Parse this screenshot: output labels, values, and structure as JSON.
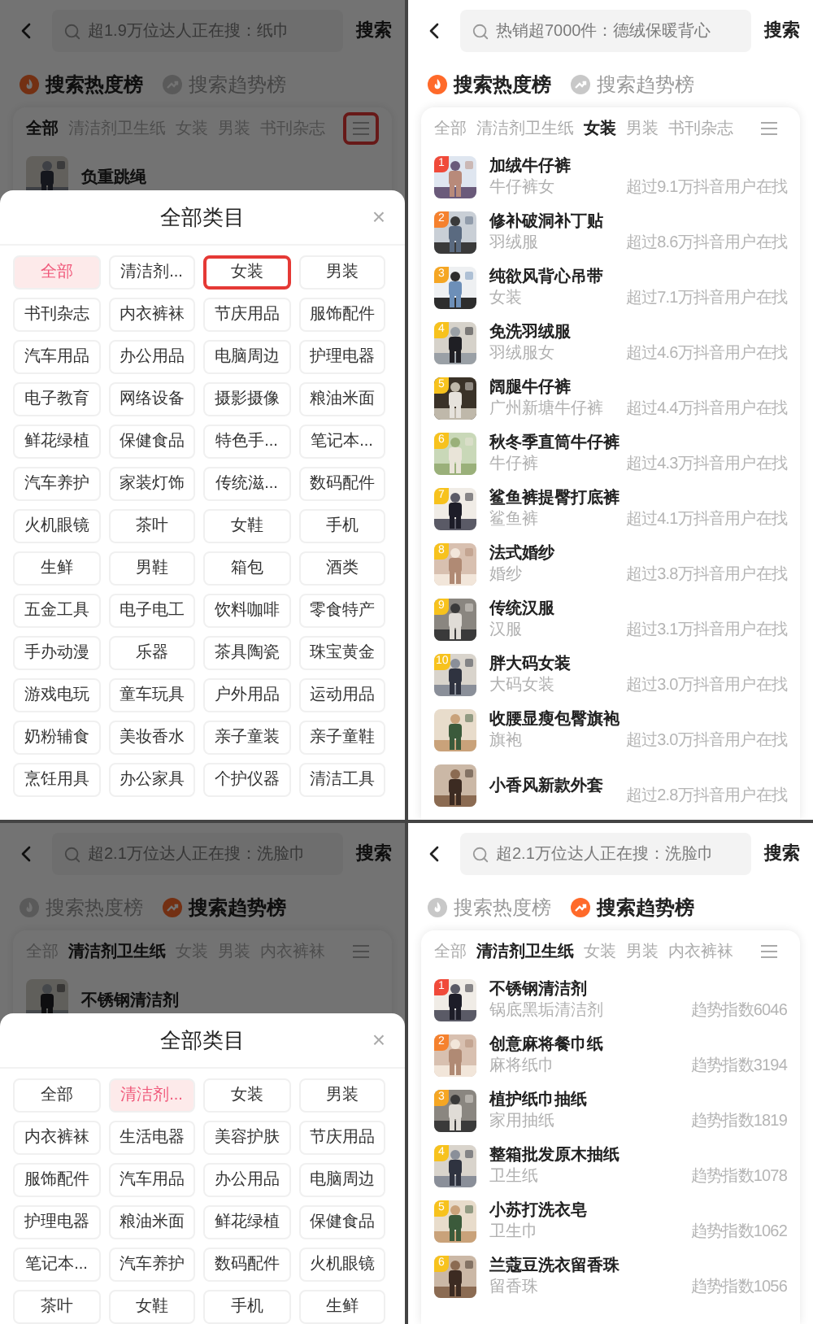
{
  "panels": [
    {
      "search": {
        "placeholder": "超1.9万位达人正在搜：纸巾",
        "button": "搜索"
      },
      "rank_tabs": [
        {
          "kind": "hot",
          "label": "搜索热度榜",
          "selected": true
        },
        {
          "kind": "trend",
          "label": "搜索趋势榜",
          "selected": false
        }
      ],
      "category_tabs": {
        "items": [
          {
            "label": "全部",
            "selected": true
          },
          {
            "label": "清洁剂卫生纸",
            "selected": false
          },
          {
            "label": "女装",
            "selected": false
          },
          {
            "label": "男装",
            "selected": false
          },
          {
            "label": "书刊杂志",
            "selected": false
          }
        ],
        "menu_annotated": true
      },
      "list": [
        {
          "title": "负重跳绳"
        }
      ],
      "sheet": {
        "title": "全部类目",
        "close": "×",
        "categories": [
          {
            "label": "全部",
            "selected": true,
            "annotated": false
          },
          {
            "label": "清洁剂...",
            "selected": false,
            "annotated": false
          },
          {
            "label": "女装",
            "selected": false,
            "annotated": true
          },
          {
            "label": "男装",
            "selected": false,
            "annotated": false
          },
          {
            "label": "书刊杂志",
            "selected": false,
            "annotated": false
          },
          {
            "label": "内衣裤袜",
            "selected": false,
            "annotated": false
          },
          {
            "label": "节庆用品",
            "selected": false,
            "annotated": false
          },
          {
            "label": "服饰配件",
            "selected": false,
            "annotated": false
          },
          {
            "label": "汽车用品",
            "selected": false,
            "annotated": false
          },
          {
            "label": "办公用品",
            "selected": false,
            "annotated": false
          },
          {
            "label": "电脑周边",
            "selected": false,
            "annotated": false
          },
          {
            "label": "护理电器",
            "selected": false,
            "annotated": false
          },
          {
            "label": "电子教育",
            "selected": false,
            "annotated": false
          },
          {
            "label": "网络设备",
            "selected": false,
            "annotated": false
          },
          {
            "label": "摄影摄像",
            "selected": false,
            "annotated": false
          },
          {
            "label": "粮油米面",
            "selected": false,
            "annotated": false
          },
          {
            "label": "鲜花绿植",
            "selected": false,
            "annotated": false
          },
          {
            "label": "保健食品",
            "selected": false,
            "annotated": false
          },
          {
            "label": "特色手...",
            "selected": false,
            "annotated": false
          },
          {
            "label": "笔记本...",
            "selected": false,
            "annotated": false
          },
          {
            "label": "汽车养护",
            "selected": false,
            "annotated": false
          },
          {
            "label": "家装灯饰",
            "selected": false,
            "annotated": false
          },
          {
            "label": "传统滋...",
            "selected": false,
            "annotated": false
          },
          {
            "label": "数码配件",
            "selected": false,
            "annotated": false
          },
          {
            "label": "火机眼镜",
            "selected": false,
            "annotated": false
          },
          {
            "label": "茶叶",
            "selected": false,
            "annotated": false
          },
          {
            "label": "女鞋",
            "selected": false,
            "annotated": false
          },
          {
            "label": "手机",
            "selected": false,
            "annotated": false
          },
          {
            "label": "生鲜",
            "selected": false,
            "annotated": false
          },
          {
            "label": "男鞋",
            "selected": false,
            "annotated": false
          },
          {
            "label": "箱包",
            "selected": false,
            "annotated": false
          },
          {
            "label": "酒类",
            "selected": false,
            "annotated": false
          },
          {
            "label": "五金工具",
            "selected": false,
            "annotated": false
          },
          {
            "label": "电子电工",
            "selected": false,
            "annotated": false
          },
          {
            "label": "饮料咖啡",
            "selected": false,
            "annotated": false
          },
          {
            "label": "零食特产",
            "selected": false,
            "annotated": false
          },
          {
            "label": "手办动漫",
            "selected": false,
            "annotated": false
          },
          {
            "label": "乐器",
            "selected": false,
            "annotated": false
          },
          {
            "label": "茶具陶瓷",
            "selected": false,
            "annotated": false
          },
          {
            "label": "珠宝黄金",
            "selected": false,
            "annotated": false
          },
          {
            "label": "游戏电玩",
            "selected": false,
            "annotated": false
          },
          {
            "label": "童车玩具",
            "selected": false,
            "annotated": false
          },
          {
            "label": "户外用品",
            "selected": false,
            "annotated": false
          },
          {
            "label": "运动用品",
            "selected": false,
            "annotated": false
          },
          {
            "label": "奶粉辅食",
            "selected": false,
            "annotated": false
          },
          {
            "label": "美妆香水",
            "selected": false,
            "annotated": false
          },
          {
            "label": "亲子童装",
            "selected": false,
            "annotated": false
          },
          {
            "label": "亲子童鞋",
            "selected": false,
            "annotated": false
          },
          {
            "label": "烹饪用具",
            "selected": false,
            "annotated": false
          },
          {
            "label": "办公家具",
            "selected": false,
            "annotated": false
          },
          {
            "label": "个护仪器",
            "selected": false,
            "annotated": false
          },
          {
            "label": "清洁工具",
            "selected": false,
            "annotated": false
          }
        ]
      }
    },
    {
      "search": {
        "placeholder": "热销超7000件：德绒保暖背心",
        "button": "搜索"
      },
      "rank_tabs": [
        {
          "kind": "hot",
          "label": "搜索热度榜",
          "selected": true
        },
        {
          "kind": "trend",
          "label": "搜索趋势榜",
          "selected": false
        }
      ],
      "category_tabs": {
        "items": [
          {
            "label": "全部",
            "selected": false
          },
          {
            "label": "清洁剂卫生纸",
            "selected": false
          },
          {
            "label": "女装",
            "selected": true
          },
          {
            "label": "男装",
            "selected": false
          },
          {
            "label": "书刊杂志",
            "selected": false
          }
        ],
        "menu_annotated": false
      },
      "list": [
        {
          "rank": "1",
          "color": "#f04a3a",
          "title": "加绒牛仔裤",
          "subtitle": "牛仔裤女",
          "reading": "超过9.1万抖音用户在找"
        },
        {
          "rank": "2",
          "color": "#f5812e",
          "title": "修补破洞补丁贴",
          "subtitle": "羽绒服",
          "reading": "超过8.6万抖音用户在找"
        },
        {
          "rank": "3",
          "color": "#f5a623",
          "title": "纯欲风背心吊带",
          "subtitle": "女装",
          "reading": "超过7.1万抖音用户在找"
        },
        {
          "rank": "4",
          "color": "#f7c21d",
          "title": "免洗羽绒服",
          "subtitle": "羽绒服女",
          "reading": "超过4.6万抖音用户在找"
        },
        {
          "rank": "5",
          "color": "#f7c21d",
          "title": "阔腿牛仔裤",
          "subtitle": "广州新塘牛仔裤",
          "reading": "超过4.4万抖音用户在找"
        },
        {
          "rank": "6",
          "color": "#f7c21d",
          "title": "秋冬季直筒牛仔裤",
          "subtitle": "牛仔裤",
          "reading": "超过4.3万抖音用户在找"
        },
        {
          "rank": "7",
          "color": "#f7c21d",
          "title": "鲨鱼裤提臀打底裤",
          "subtitle": "鲨鱼裤",
          "reading": "超过4.1万抖音用户在找"
        },
        {
          "rank": "8",
          "color": "#f7c21d",
          "title": "法式婚纱",
          "subtitle": "婚纱",
          "reading": "超过3.8万抖音用户在找"
        },
        {
          "rank": "9",
          "color": "#f7c21d",
          "title": "传统汉服",
          "subtitle": "汉服",
          "reading": "超过3.1万抖音用户在找"
        },
        {
          "rank": "10",
          "color": "#f7c21d",
          "title": "胖大码女装",
          "subtitle": "大码女装",
          "reading": "超过3.0万抖音用户在找"
        },
        {
          "title": "收腰显瘦包臀旗袍",
          "subtitle": "旗袍",
          "reading": "超过3.0万抖音用户在找"
        },
        {
          "title": "小香风新款外套",
          "reading": "超过2.8万抖音用户在找"
        }
      ]
    },
    {
      "search": {
        "placeholder": "超2.1万位达人正在搜：洗脸巾",
        "button": "搜索"
      },
      "rank_tabs": [
        {
          "kind": "hot",
          "label": "搜索热度榜",
          "selected": false
        },
        {
          "kind": "trend",
          "label": "搜索趋势榜",
          "selected": true
        }
      ],
      "category_tabs": {
        "items": [
          {
            "label": "全部",
            "selected": false
          },
          {
            "label": "清洁剂卫生纸",
            "selected": true
          },
          {
            "label": "女装",
            "selected": false
          },
          {
            "label": "男装",
            "selected": false
          },
          {
            "label": "内衣裤袜",
            "selected": false
          }
        ],
        "menu_annotated": false
      },
      "list": [
        {
          "title": "不锈钢清洁剂"
        }
      ],
      "sheet": {
        "title": "全部类目",
        "close": "×",
        "categories": [
          {
            "label": "全部",
            "selected": false,
            "annotated": false
          },
          {
            "label": "清洁剂...",
            "selected": true,
            "annotated": false
          },
          {
            "label": "女装",
            "selected": false,
            "annotated": false
          },
          {
            "label": "男装",
            "selected": false,
            "annotated": false
          },
          {
            "label": "内衣裤袜",
            "selected": false,
            "annotated": false
          },
          {
            "label": "生活电器",
            "selected": false,
            "annotated": false
          },
          {
            "label": "美容护肤",
            "selected": false,
            "annotated": false
          },
          {
            "label": "节庆用品",
            "selected": false,
            "annotated": false
          },
          {
            "label": "服饰配件",
            "selected": false,
            "annotated": false
          },
          {
            "label": "汽车用品",
            "selected": false,
            "annotated": false
          },
          {
            "label": "办公用品",
            "selected": false,
            "annotated": false
          },
          {
            "label": "电脑周边",
            "selected": false,
            "annotated": false
          },
          {
            "label": "护理电器",
            "selected": false,
            "annotated": false
          },
          {
            "label": "粮油米面",
            "selected": false,
            "annotated": false
          },
          {
            "label": "鲜花绿植",
            "selected": false,
            "annotated": false
          },
          {
            "label": "保健食品",
            "selected": false,
            "annotated": false
          },
          {
            "label": "笔记本...",
            "selected": false,
            "annotated": false
          },
          {
            "label": "汽车养护",
            "selected": false,
            "annotated": false
          },
          {
            "label": "数码配件",
            "selected": false,
            "annotated": false
          },
          {
            "label": "火机眼镜",
            "selected": false,
            "annotated": false
          },
          {
            "label": "茶叶",
            "selected": false,
            "annotated": false
          },
          {
            "label": "女鞋",
            "selected": false,
            "annotated": false
          },
          {
            "label": "手机",
            "selected": false,
            "annotated": false
          },
          {
            "label": "生鲜",
            "selected": false,
            "annotated": false
          }
        ]
      }
    },
    {
      "search": {
        "placeholder": "超2.1万位达人正在搜：洗脸巾",
        "button": "搜索"
      },
      "rank_tabs": [
        {
          "kind": "hot",
          "label": "搜索热度榜",
          "selected": false
        },
        {
          "kind": "trend",
          "label": "搜索趋势榜",
          "selected": true
        }
      ],
      "category_tabs": {
        "items": [
          {
            "label": "全部",
            "selected": false
          },
          {
            "label": "清洁剂卫生纸",
            "selected": true
          },
          {
            "label": "女装",
            "selected": false
          },
          {
            "label": "男装",
            "selected": false
          },
          {
            "label": "内衣裤袜",
            "selected": false
          }
        ],
        "menu_annotated": false
      },
      "list": [
        {
          "rank": "1",
          "color": "#f04a3a",
          "title": "不锈钢清洁剂",
          "subtitle": "锅底黑垢清洁剂",
          "reading": "趋势指数6046"
        },
        {
          "rank": "2",
          "color": "#f5812e",
          "title": "创意麻将餐巾纸",
          "subtitle": "麻将纸巾",
          "reading": "趋势指数3194"
        },
        {
          "rank": "3",
          "color": "#f5a623",
          "title": "植护纸巾抽纸",
          "subtitle": "家用抽纸",
          "reading": "趋势指数1819"
        },
        {
          "rank": "4",
          "color": "#f7c21d",
          "title": "整箱批发原木抽纸",
          "subtitle": "卫生纸",
          "reading": "趋势指数1078"
        },
        {
          "rank": "5",
          "color": "#f7c21d",
          "title": "小苏打洗衣皂",
          "subtitle": "卫生巾",
          "reading": "趋势指数1062"
        },
        {
          "rank": "6",
          "color": "#f7c21d",
          "title": "兰蔻豆洗衣留香珠",
          "subtitle": "留香珠",
          "reading": "趋势指数1056"
        }
      ]
    }
  ]
}
